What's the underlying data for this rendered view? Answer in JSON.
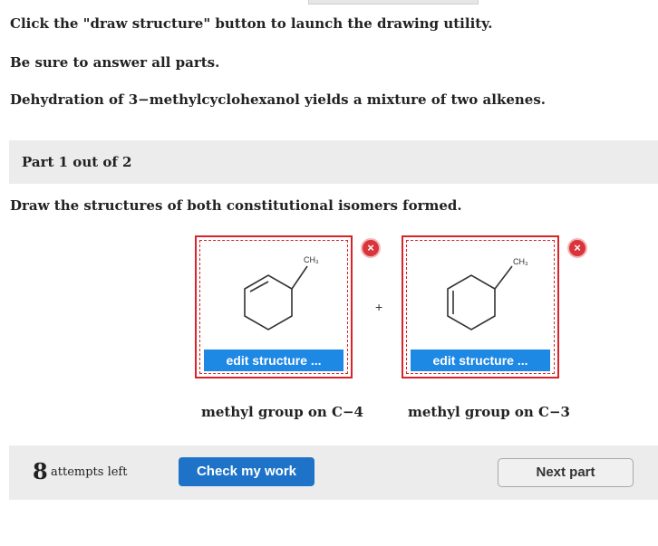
{
  "instructions": {
    "line1": "Click the \"draw structure\" button to launch the drawing utility.",
    "line2": "Be sure to answer all parts.",
    "line3": "Dehydration of 3−methylcyclohexanol yields a mixture of two alkenes."
  },
  "part": {
    "label": "Part 1 out of 2"
  },
  "question": "Draw the structures of both constitutional isomers formed.",
  "structures": [
    {
      "label": "CH₃",
      "edit_label": "edit structure ...",
      "caption": "methyl group on C−4"
    },
    {
      "label": "CH₃",
      "edit_label": "edit structure ...",
      "caption": "methyl group on C−3"
    }
  ],
  "remove_symbol": "×",
  "plus": "+",
  "footer": {
    "attempts_count": "8",
    "attempts_label": "attempts left",
    "check_label": "Check my work",
    "next_label": "Next part"
  },
  "colors": {
    "accent_blue": "#1e88e5",
    "error_red": "#d9232b"
  }
}
